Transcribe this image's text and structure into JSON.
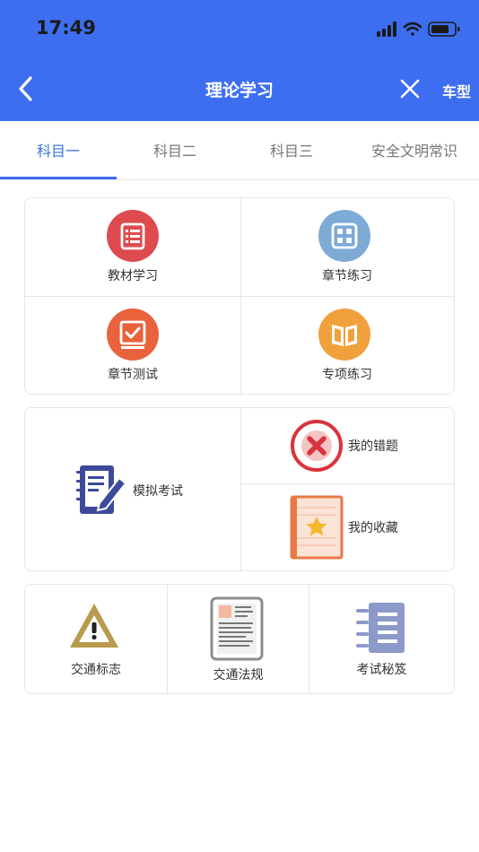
{
  "status_bar": {
    "time": "17:49"
  },
  "nav": {
    "title": "理论学习",
    "right_label": "车型"
  },
  "tabs": [
    {
      "label": "科目一",
      "active": true
    },
    {
      "label": "科目二",
      "active": false
    },
    {
      "label": "科目三",
      "active": false
    },
    {
      "label": "安全文明常识",
      "active": false
    }
  ],
  "study_grid": [
    {
      "label": "教材学习",
      "icon": "list-icon",
      "color": "#dd4b4e"
    },
    {
      "label": "章节练习",
      "icon": "grid-icon",
      "color": "#7eaad6"
    },
    {
      "label": "章节测试",
      "icon": "check-icon",
      "color": "#e8623c"
    },
    {
      "label": "专项练习",
      "icon": "book-icon",
      "color": "#f0a13c"
    }
  ],
  "exam_section": {
    "mock_exam_label": "模拟考试",
    "wrong_questions_label": "我的错题",
    "favorites_label": "我的收藏"
  },
  "bottom_section": [
    {
      "label": "交通标志",
      "icon": "warning-sign-icon"
    },
    {
      "label": "交通法规",
      "icon": "document-icon"
    },
    {
      "label": "考试秘笈",
      "icon": "notebook-icon"
    }
  ]
}
